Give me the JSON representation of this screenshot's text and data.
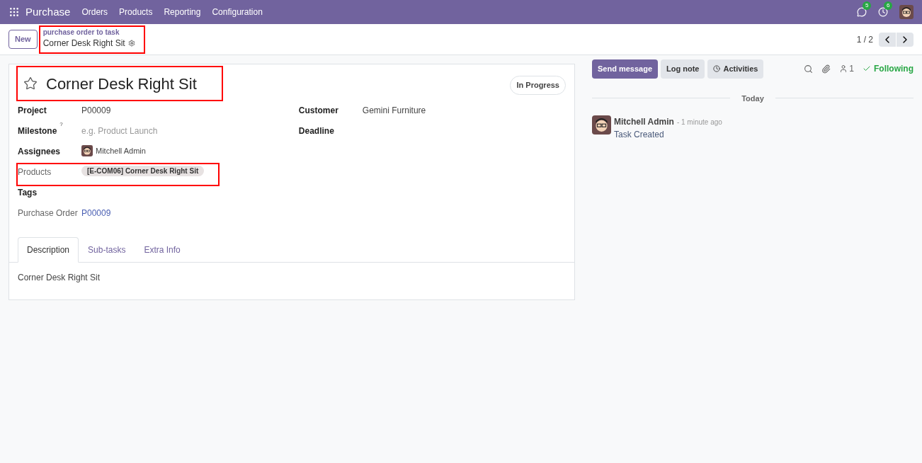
{
  "navbar": {
    "app": "Purchase",
    "menu": [
      "Orders",
      "Products",
      "Reporting",
      "Configuration"
    ],
    "messages_badge": "5",
    "activities_badge": "6"
  },
  "control_panel": {
    "new_button": "New",
    "breadcrumb_parent": "purchase order to task",
    "breadcrumb_current": "Corner Desk Right Sit",
    "highlighted": true,
    "pager": "1 / 2"
  },
  "form": {
    "title": "Corner Desk Right Sit",
    "title_highlighted": true,
    "starred": false,
    "stage": "In Progress",
    "left_fields": [
      {
        "label": "Project",
        "bold": true,
        "kind": "text",
        "value": "P00009",
        "highlighted": false
      },
      {
        "label": "Milestone",
        "bold": true,
        "help": "?",
        "kind": "placeholder",
        "placeholder": "e.g. Product Launch",
        "highlighted": false
      },
      {
        "label": "Assignees",
        "bold": true,
        "kind": "avatar",
        "value": "Mitchell Admin",
        "highlighted": false
      },
      {
        "label": "Products",
        "bold": false,
        "kind": "tag",
        "value": "[E-COM06] Corner Desk Right Sit",
        "highlighted": true
      },
      {
        "label": "Tags",
        "bold": true,
        "kind": "empty",
        "highlighted": false
      },
      {
        "label": "Purchase Order",
        "bold": false,
        "kind": "link",
        "value": "P00009",
        "highlighted": false
      }
    ],
    "right_fields": [
      {
        "label": "Customer",
        "bold": true,
        "kind": "text",
        "value": "Gemini Furniture"
      },
      {
        "label": "Deadline",
        "bold": true,
        "kind": "empty"
      }
    ],
    "tabs": [
      {
        "label": "Description",
        "selected": true
      },
      {
        "label": "Sub-tasks",
        "selected": false
      },
      {
        "label": "Extra Info",
        "selected": false
      }
    ],
    "description": "Corner Desk Right Sit"
  },
  "chatter": {
    "buttons": [
      {
        "label": "Send message",
        "kind": "primary"
      },
      {
        "label": "Log note",
        "kind": "secondary"
      },
      {
        "label": "Activities",
        "kind": "activities"
      }
    ],
    "followers": "1",
    "following": "Following",
    "date_separator": "Today",
    "messages": [
      {
        "author": "Mitchell Admin",
        "time": "- 1 minute ago",
        "body": "Task Created"
      }
    ]
  }
}
